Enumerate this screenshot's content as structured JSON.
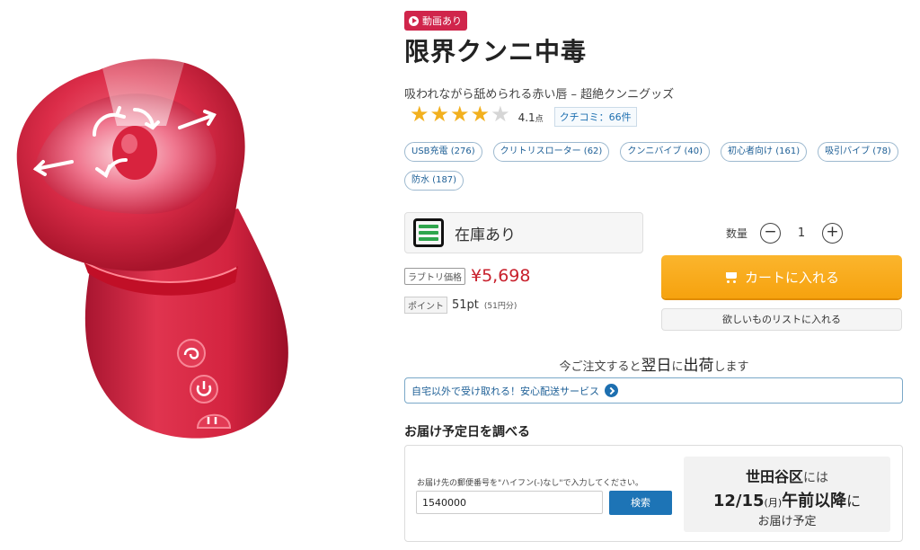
{
  "product": {
    "video_badge": "動画あり",
    "title": "限界クンニ中毒",
    "subtitle": "吸われながら舐められる赤い唇 – 超絶クンニグッズ",
    "rating_value": 4.1,
    "rating_text": "4.1",
    "rating_unit": "点",
    "review_link": "クチコミ：66件",
    "stars_filled": 4,
    "stars_total": 5
  },
  "tags": [
    "USB充電 (276)",
    "クリトリスローター (62)",
    "クンニバイブ (40)",
    "初心者向け (161)",
    "吸引バイブ (78)",
    "防水 (187)"
  ],
  "stock": {
    "label": "在庫あり"
  },
  "quantity": {
    "label": "数量",
    "value": "1",
    "minus": "−",
    "plus": "+"
  },
  "price": {
    "tag": "ラブトリ価格",
    "value": "¥5,698"
  },
  "points": {
    "tag": "ポイント",
    "value": "51pt",
    "yen": "(51円分)"
  },
  "cart": {
    "label": "カートに入れる"
  },
  "wishlist": {
    "label": "欲しいものリストに入れる"
  },
  "shipping": {
    "prefix": "今ご注文すると",
    "next_day": "翌日",
    "mid": "に",
    "ship": "出荷",
    "suffix": "します"
  },
  "home_delivery": {
    "label": "自宅以外で受け取れる！安心配送サービス"
  },
  "delivery": {
    "title": "お届け予定日を調べる",
    "note": "お届け先の郵便番号を\"ハイフン(-)なし\"で入力してください。",
    "zip": "1540000",
    "search": "検索",
    "area": "世田谷区",
    "area_suffix": "には",
    "date": "12/15",
    "dow": "(月)",
    "time": "午前以降",
    "time_suffix": "に",
    "line3": "お届け予定"
  },
  "colors": {
    "badge": "#d0254b",
    "star": "#f2b01e",
    "price": "#c8202c",
    "cart": "#f6a20e",
    "link": "#1d6fb0",
    "product_red": "#d8233e"
  },
  "image": {
    "icon_names": [
      "suction-arrows-icon",
      "power-icon",
      "mode-icon"
    ]
  }
}
